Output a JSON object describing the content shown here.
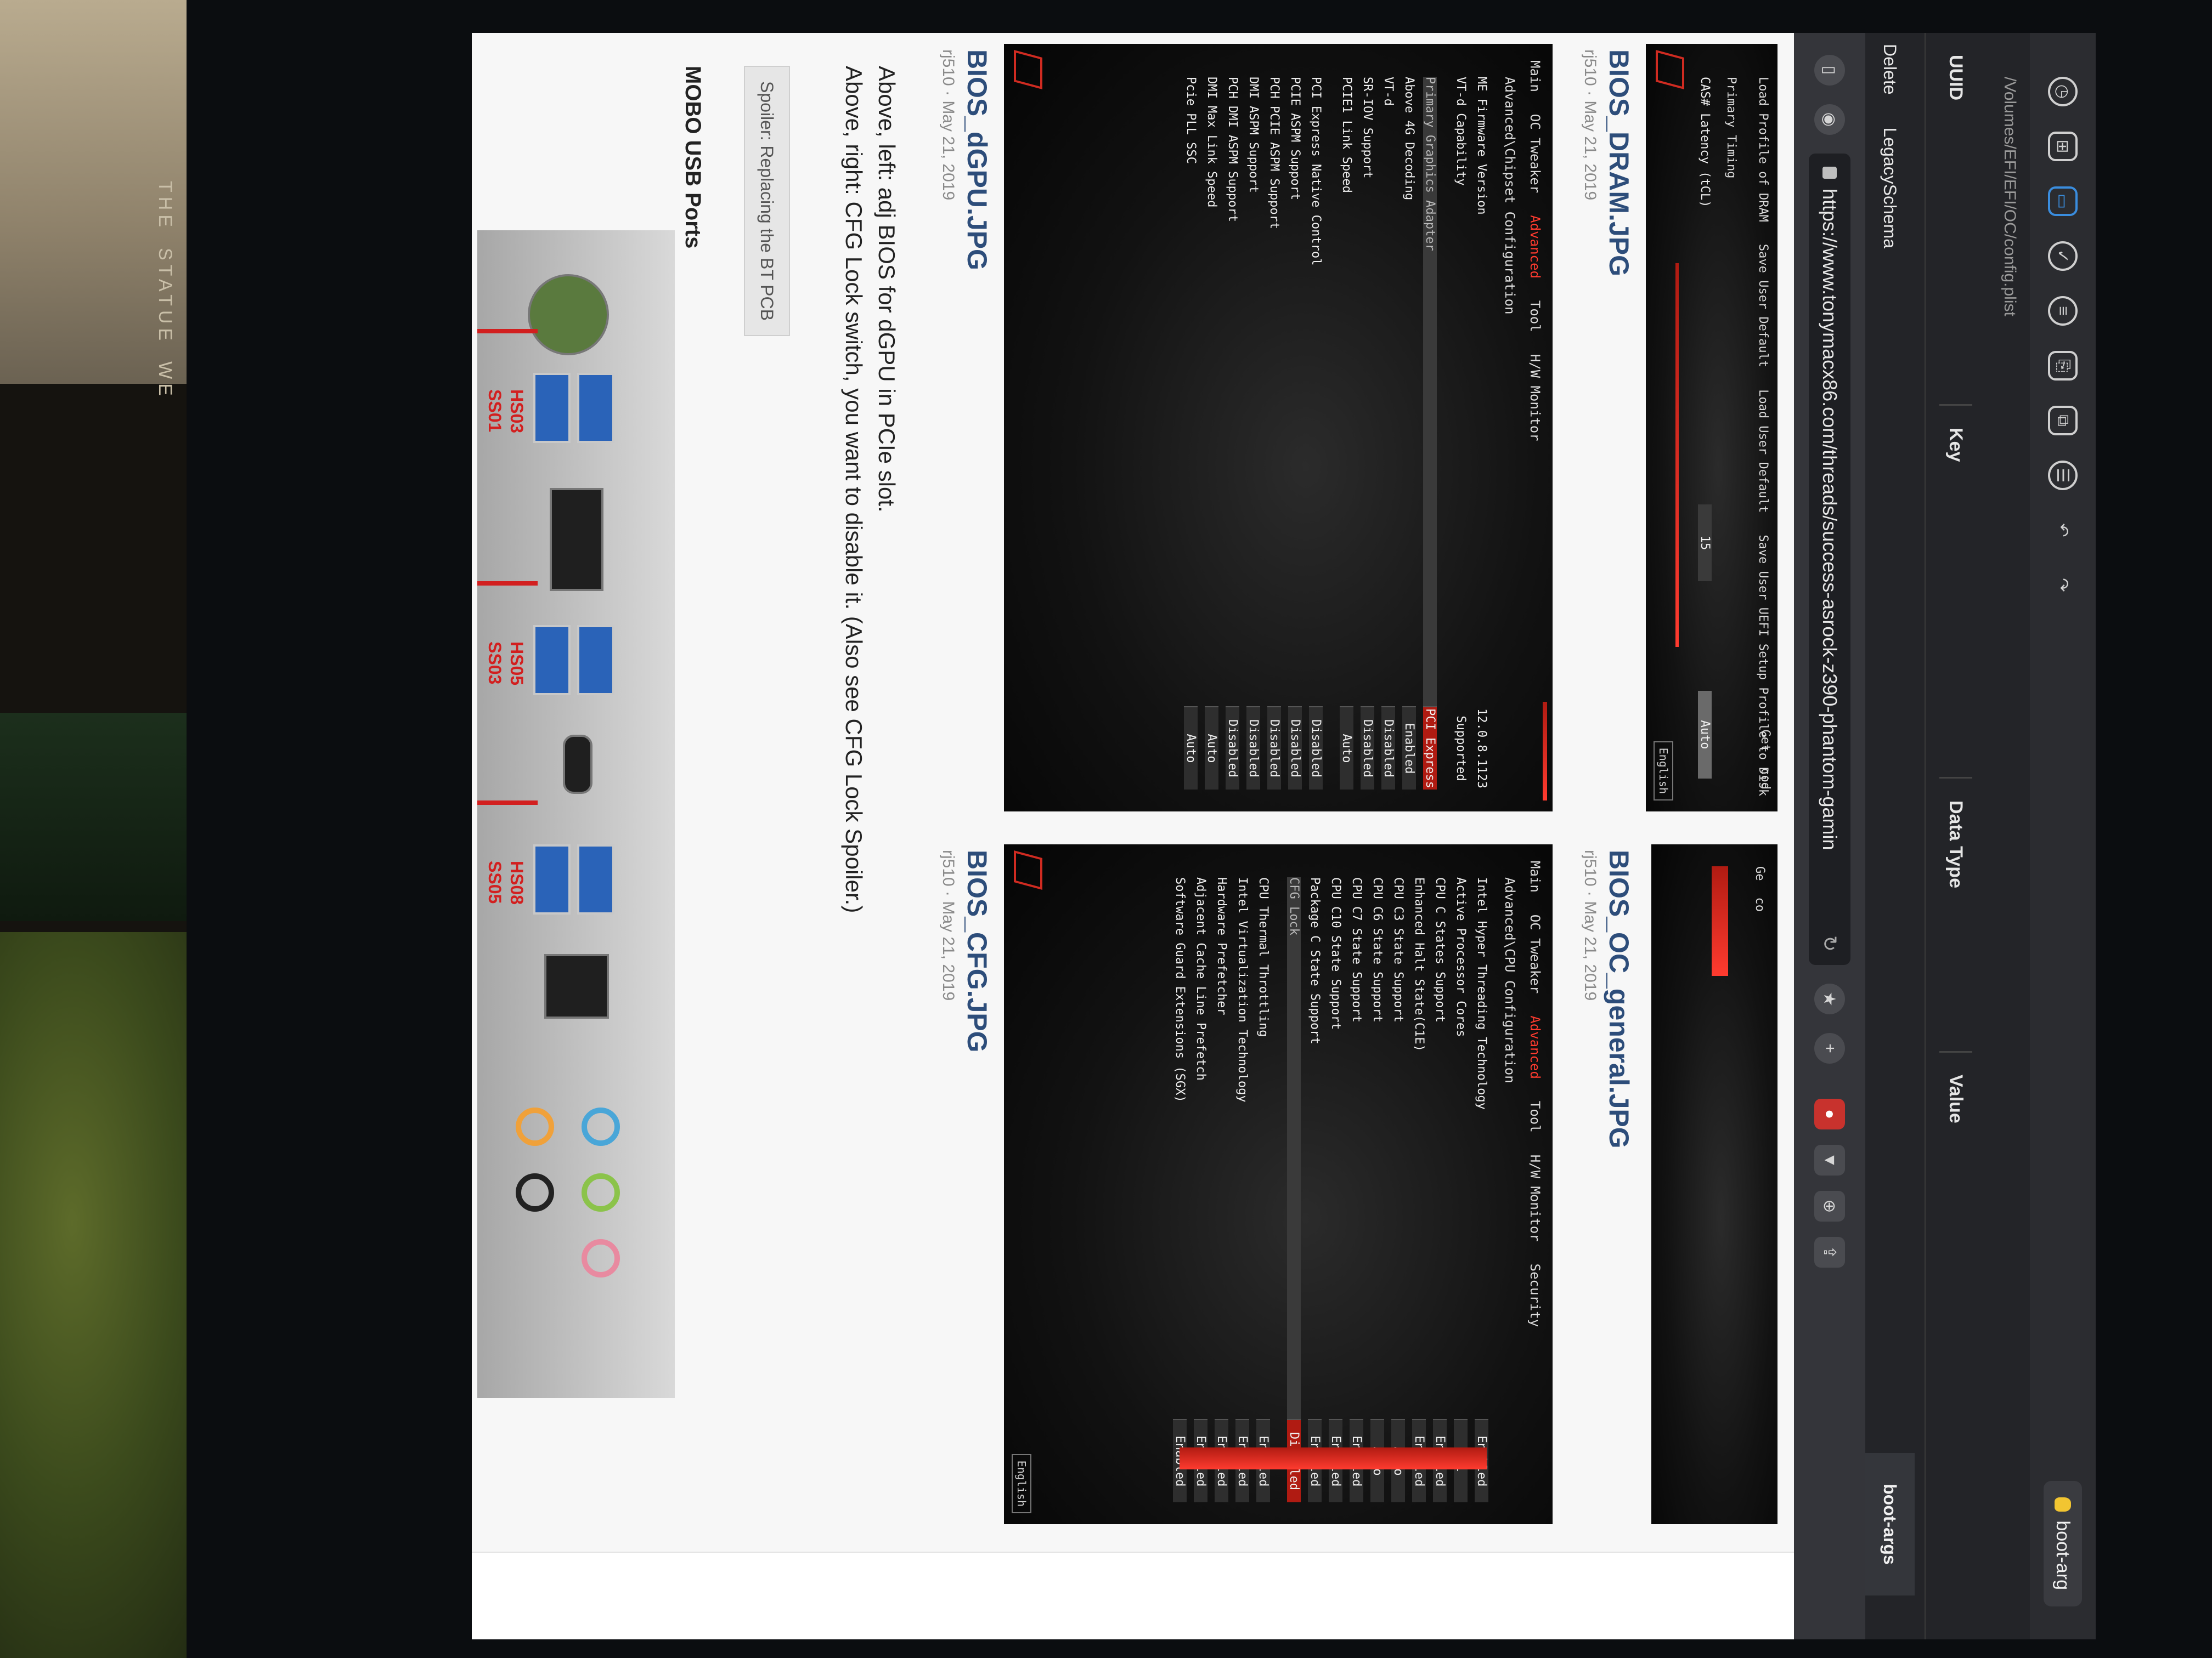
{
  "photo": {
    "bezel_tags": [
      "THE",
      "STATUE",
      "WE"
    ]
  },
  "editor": {
    "toolbar_icons": [
      "history-icon",
      "grid-icon",
      "sidebar-icon",
      "clock-icon",
      "list-icon",
      "copy-icon",
      "duplicate-icon",
      "database-icon",
      "undo-icon",
      "redo-icon"
    ],
    "search_value": "boot-arg",
    "path": "/Volumes/EFI/EFI/OC/config.plist",
    "columns": {
      "uuid": "UUID",
      "key": "Key",
      "type": "Data Type",
      "value": "Value"
    },
    "side_items": {
      "delete": "Delete",
      "legacy": "LegacySchema"
    },
    "tab": "boot-args"
  },
  "browser": {
    "url": "https://www.tonymacx86.com/threads/success-asrock-z390-phantom-gamin"
  },
  "attachments": [
    {
      "title": "BIOS_DRAM.JPG",
      "meta": "rj510 · May 21, 2019",
      "bios": {
        "menu": [
          "Load Profile of DRAM",
          "Save User Default",
          "Load User Default",
          "Save User UEFI Setup Profile to Disk"
        ],
        "side": [
          "Get",
          "cod"
        ],
        "section": "Primary Timing",
        "row_key": "CAS# Latency (tCL)",
        "row_val1": "15",
        "row_val2": "Auto",
        "lang": "English"
      }
    },
    {
      "title": "BIOS_OC_general.JPG",
      "meta": "rj510 · May 21, 2019",
      "bios": {
        "tabs": [
          "Main",
          "OC Tweaker",
          "Advanced",
          "Tool",
          "H/W Monitor",
          "Security"
        ],
        "path": "Advanced\\CPU Configuration",
        "rows": [
          {
            "k": "Intel Hyper Threading Technology",
            "v": "Enabled"
          },
          {
            "k": "Active Processor Cores",
            "v": "All"
          },
          {
            "k": "CPU C States Support",
            "v": "Enabled"
          },
          {
            "k": "Enhanced Halt State(C1E)",
            "v": "Enabled"
          },
          {
            "k": "CPU C3 State Support",
            "v": "Auto"
          },
          {
            "k": "CPU C6 State Support",
            "v": "Auto"
          },
          {
            "k": "CPU C7 State Support",
            "v": "Enabled"
          },
          {
            "k": "CPU C10 State Support",
            "v": "Enabled"
          },
          {
            "k": "Package C State Support",
            "v": "Enabled"
          },
          {
            "k": "CFG Lock",
            "v": "Disabled"
          },
          {
            "k": "CPU Thermal Throttling",
            "v": "Enabled"
          },
          {
            "k": "Intel Virtualization Technology",
            "v": "Enabled"
          },
          {
            "k": "Hardware Prefetcher",
            "v": "Enabled"
          },
          {
            "k": "Adjacent Cache Line Prefetch",
            "v": "Enabled"
          },
          {
            "k": "Software Guard Extensions (SGX)",
            "v": "Enabled"
          }
        ],
        "side": [
          "Ge",
          "co"
        ],
        "lang": "English"
      }
    },
    {
      "title": "BIOS_dGPU.JPG",
      "meta": "rj510 · May 21, 2019",
      "bios": {
        "tabs": [
          "Main",
          "OC Tweaker",
          "Advanced",
          "Tool",
          "H/W Monitor"
        ],
        "path": "Advanced\\Chipset Configuration",
        "rows": [
          {
            "k": "ME Firmware Version",
            "v": "12.0.8.1123"
          },
          {
            "k": "VT-d Capability",
            "v": "Supported"
          },
          {
            "k": "Primary Graphics Adapter",
            "v": "PCI Express"
          },
          {
            "k": "Above 4G Decoding",
            "v": "Enabled"
          },
          {
            "k": "VT-d",
            "v": "Disabled"
          },
          {
            "k": "SR-IOV Support",
            "v": "Disabled"
          },
          {
            "k": "PCIE1 Link Speed",
            "v": "Auto"
          },
          {
            "k": "PCI Express Native Control",
            "v": "Disabled"
          },
          {
            "k": "PCIE ASPM Support",
            "v": "Disabled"
          },
          {
            "k": "PCH PCIE ASPM Support",
            "v": "Disabled"
          },
          {
            "k": "DMI ASPM Support",
            "v": "Disabled"
          },
          {
            "k": "PCH DMI ASPM Support",
            "v": "Disabled"
          },
          {
            "k": "DMI Max Link Speed",
            "v": "Auto"
          },
          {
            "k": "Pcie PLL SSC",
            "v": "Auto"
          }
        ]
      }
    },
    {
      "title": "BIOS_CFG.JPG",
      "meta": "rj510 · May 21, 2019"
    }
  ],
  "post": {
    "caption_1": "Above, left: adj BIOS for dGPU in PCIe slot.",
    "caption_2": "Above, right: CFG Lock switch, you want to disable it. (Also see CFG Lock Spoiler.)",
    "spoiler": "Spoiler: Replacing the BT PCB",
    "usb_title": "MOBO USB Ports",
    "usb_labels": [
      [
        "HS03",
        "SS01"
      ],
      [
        "HS05",
        "SS03"
      ],
      [
        "HS08",
        "SS05"
      ]
    ]
  },
  "colors": {
    "accent_red": "#d21f1f",
    "link_blue": "#2d4d7a",
    "bios_red": "#b01b12"
  }
}
